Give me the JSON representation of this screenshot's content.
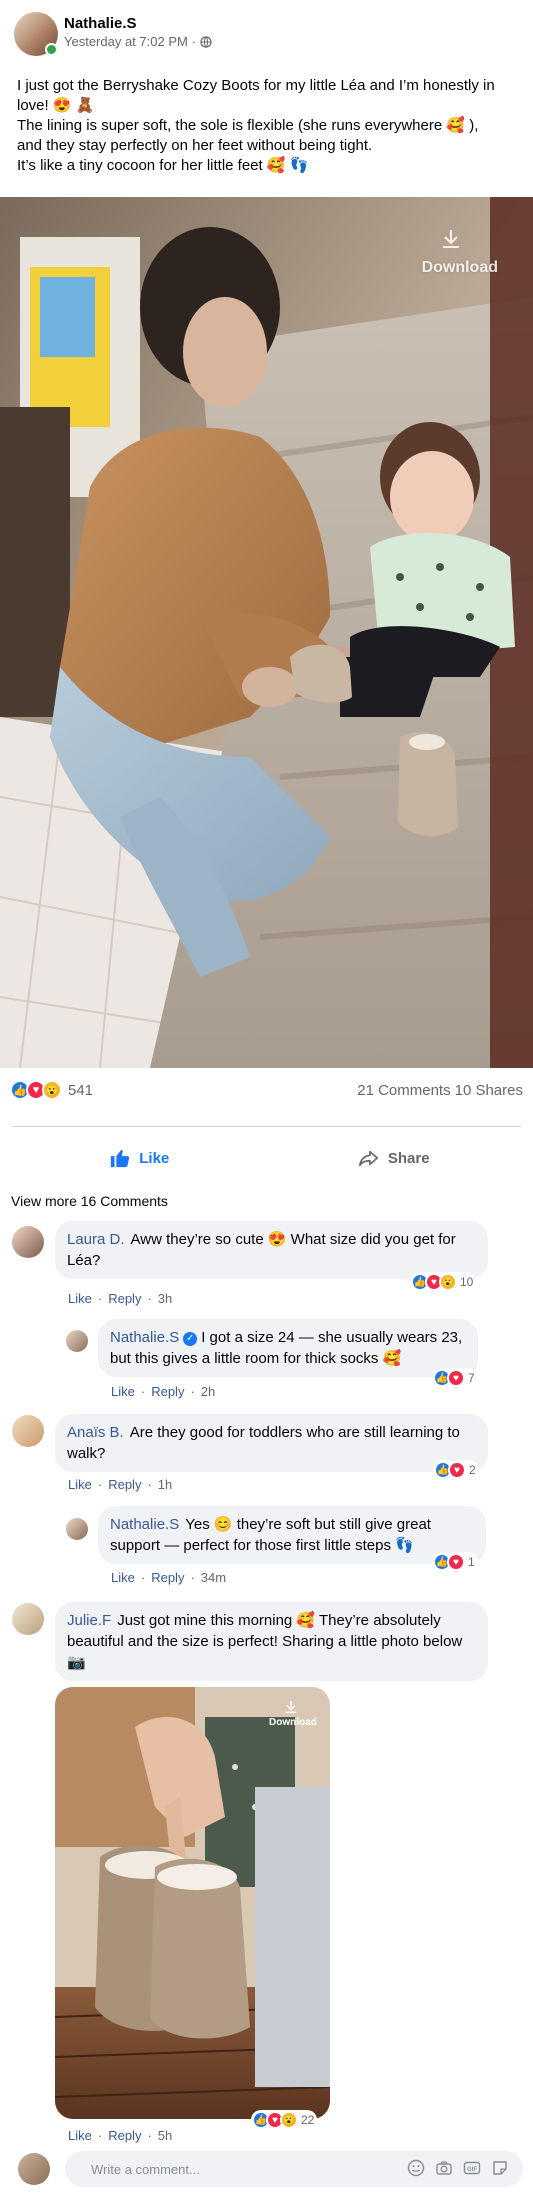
{
  "post": {
    "author": "Nathalie.S",
    "timestamp": "Yesterday at 7:02 PM",
    "text_lines": [
      "I just got the Berryshake Cozy Boots for my little Léa and I’m honestly in love! 😍 🧸",
      "The lining is super soft, the sole is flexible (she runs everywhere 🥰 ),",
      "and they stay perfectly on her feet without being tight.",
      "It’s like a tiny cocoon for her little feet 🥰 👣"
    ],
    "media_download_label": "Download",
    "reactions_count": "541",
    "comments_count": "21 Comments",
    "shares_count": "10 Shares",
    "like_label": "Like",
    "share_label": "Share",
    "view_more": "View more 16 Comments"
  },
  "comments": [
    {
      "author": "Laura D.",
      "text": "Aww they’re so cute 😍 What size did you get for Léa?",
      "like": "Like",
      "reply": "Reply",
      "time": "3h",
      "reactions": "10"
    },
    {
      "author": "Nathalie.S",
      "text": "I got a size 24 — she usually wears 23, but this gives a little room for thick socks 🥰",
      "like": "Like",
      "reply": "Reply",
      "time": "2h",
      "reactions": "7"
    },
    {
      "author": "Anaïs B.",
      "text": "Are they good for toddlers who are still learning to walk?",
      "like": "Like",
      "reply": "Reply",
      "time": "1h",
      "reactions": "2"
    },
    {
      "author": "Nathalie.S",
      "text": "Yes 😊 they’re soft but still give great support — perfect for those first little steps 👣",
      "like": "Like",
      "reply": "Reply",
      "time": "34m",
      "reactions": "1"
    },
    {
      "author": "Julie.F",
      "text": "Just got mine this morning 🥰 They’re absolutely beautiful and the size is perfect! Sharing a little photo below 📷",
      "like": "Like",
      "reply": "Reply",
      "time": "5h",
      "reactions": "22",
      "photo_download_label": "Download"
    }
  ],
  "composer": {
    "placeholder": "Write a comment..."
  },
  "colors": {
    "like_blue": "#1877f2",
    "love_red": "#f02849",
    "wow_yellow": "#f7b125",
    "name_blue": "#385898",
    "bubble_grey": "#f0f2f5",
    "meta_grey": "#65676b"
  }
}
